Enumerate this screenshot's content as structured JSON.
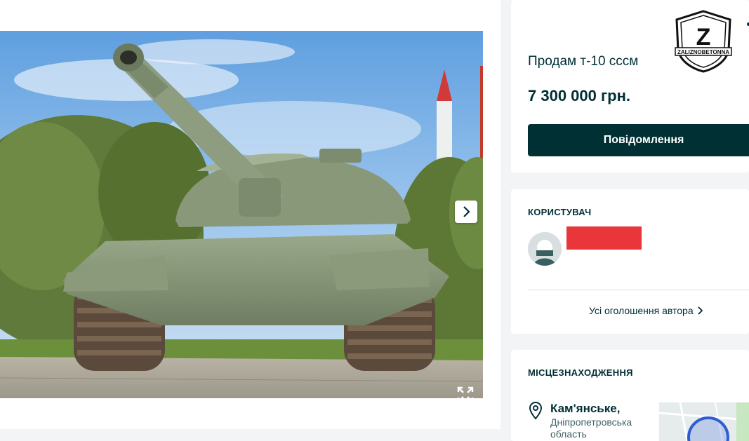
{
  "ad": {
    "title": "Продам т-10 сссм",
    "price": "7 300 000 грн.",
    "message_button": "Повідомлення"
  },
  "user": {
    "section_title": "КОРИСТУВАЧ",
    "all_ads_link": "Усі оголошення автора"
  },
  "location": {
    "section_title": "МІСЦЕЗНАХОДЖЕННЯ",
    "city": "Кам'янське,",
    "region": "Дніпропетровська область"
  },
  "watermark": {
    "logo_text": "ZALIZNOBETONNA"
  },
  "icons": {
    "next": "chevron-right-icon",
    "fullscreen": "expand-icon",
    "pin": "map-pin-icon",
    "all_ads_chevron": "chevron-right-icon"
  },
  "colors": {
    "primary": "#002f34",
    "redaction": "#e8363b",
    "background": "#f2f4f5"
  }
}
